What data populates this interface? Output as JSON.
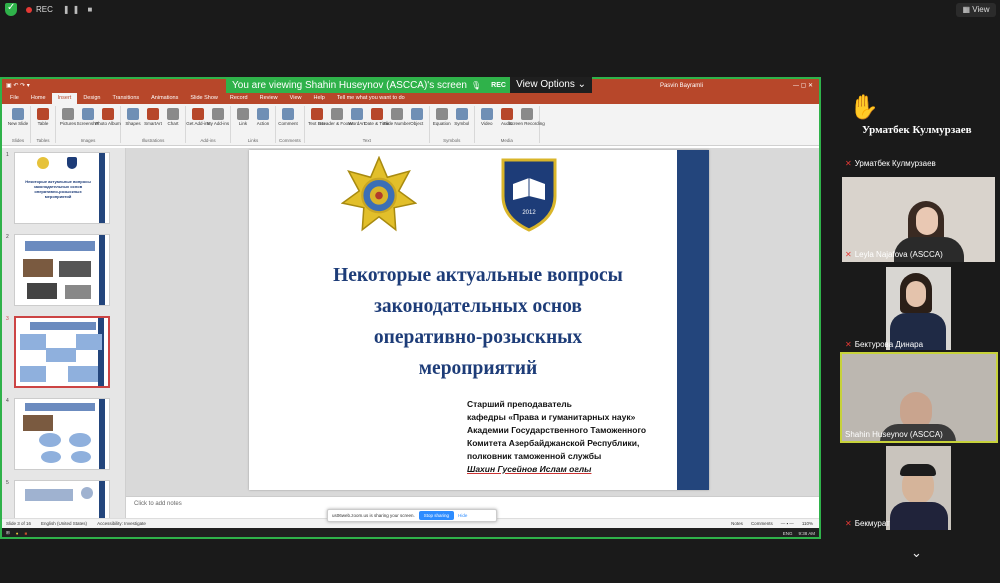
{
  "zoom": {
    "rec_label": "REC",
    "view_label": "View",
    "banner_text": "You are viewing Shahin Huseynov (ASCCA)'s screen",
    "banner_rec": "REC",
    "view_options": "View Options"
  },
  "ppt": {
    "user": "Pasvin Bayramli",
    "tabs": [
      "File",
      "Home",
      "Insert",
      "Design",
      "Transitions",
      "Animations",
      "Slide Show",
      "Record",
      "Review",
      "View",
      "Help",
      "Tell me what you want to do"
    ],
    "ribbon": [
      {
        "group": "Slides",
        "items": [
          "New Slide"
        ]
      },
      {
        "group": "Tables",
        "items": [
          "Table"
        ]
      },
      {
        "group": "Images",
        "items": [
          "Pictures",
          "Screenshot",
          "Photo Album"
        ]
      },
      {
        "group": "Illustrations",
        "items": [
          "Shapes",
          "SmartArt",
          "Chart"
        ]
      },
      {
        "group": "Add-ins",
        "items": [
          "Get Add-ins",
          "My Add-ins"
        ]
      },
      {
        "group": "Links",
        "items": [
          "Link",
          "Action"
        ]
      },
      {
        "group": "Comments",
        "items": [
          "Comment"
        ]
      },
      {
        "group": "Text",
        "items": [
          "Text Box",
          "Header & Footer",
          "WordArt",
          "Date & Time",
          "Slide Number",
          "Object"
        ]
      },
      {
        "group": "Symbols",
        "items": [
          "Equation",
          "Symbol"
        ]
      },
      {
        "group": "Media",
        "items": [
          "Video",
          "Audio",
          "Screen Recording"
        ]
      }
    ],
    "thumb_numbers": [
      "1",
      "2",
      "3",
      "4",
      "5"
    ],
    "thumb1_title": "Некоторые актуальные вопросы законодательных основ оперативно-розыскных мероприятий",
    "slide": {
      "title_lines": [
        "Некоторые актуальные вопросы",
        "законодательных основ",
        "оперативно-розыскных",
        "мероприятий"
      ],
      "author_lines": [
        "Старший преподаватель",
        "кафедры «Права и гуманитарных наук»",
        "Академии Государственного Таможенного",
        "Комитета Азербайджанской Республики,",
        "полковник таможенной службы"
      ],
      "author_name": "Шахин Гусейнов Ислам оглы",
      "emblem_year": "2012"
    },
    "notes_placeholder": "Click to add notes",
    "status": {
      "slide_of": "Slide 3 of 16",
      "language": "English (United States)",
      "accessibility": "Accessibility: Investigate",
      "notes": "Notes",
      "comments": "Comments",
      "zoom": "110%"
    },
    "sharing_pill": {
      "text": "us06web.zoom.us is sharing your screen.",
      "stop": "Stop sharing",
      "hide": "Hide"
    },
    "taskbar": {
      "lang": "ENG",
      "time": "9:38 AM"
    }
  },
  "participants": {
    "raised": {
      "name": "Урматбек Кулмурзаев",
      "label": "Урматбек Кулмурзаев"
    },
    "tiles": [
      {
        "name": "Leyla Najafova (ASCCA)"
      },
      {
        "name": "Бектурова Динара"
      },
      {
        "name": "Shahin Huseynov (ASCCA)"
      },
      {
        "name": "Бекмурат"
      }
    ]
  }
}
